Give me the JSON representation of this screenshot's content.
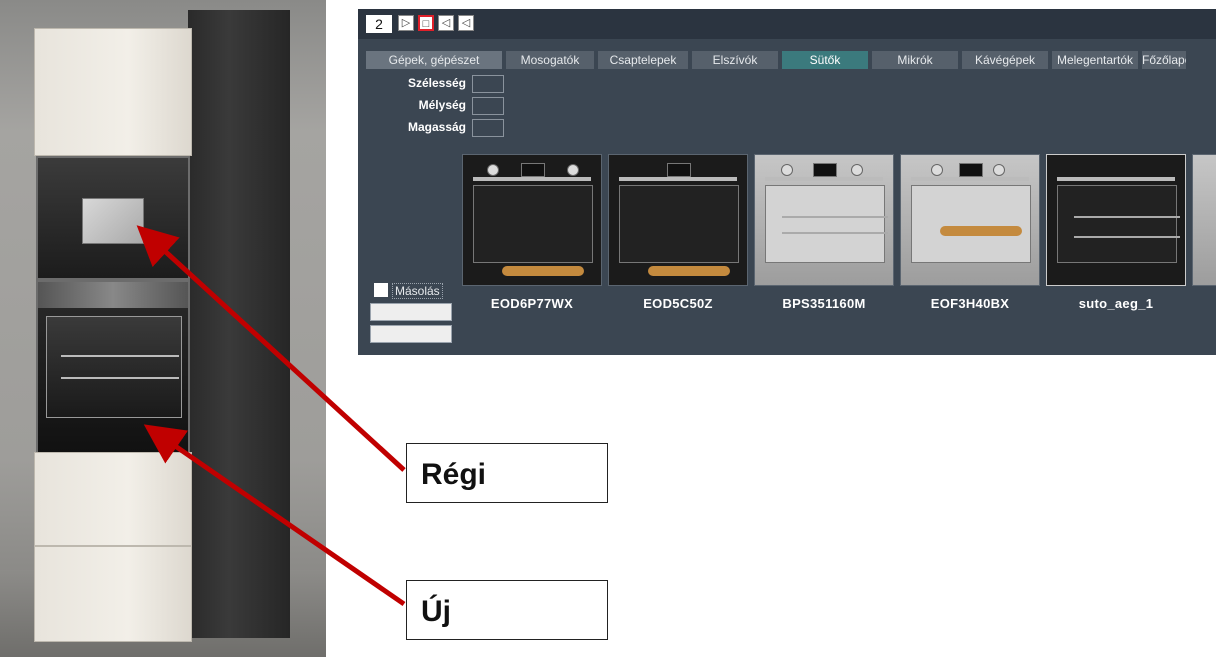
{
  "toolbar": {
    "number": "2"
  },
  "categories": [
    "Gépek, gépészet",
    "Mosogatók",
    "Csaptelepek",
    "Elszívók",
    "Sütők",
    "Mikrók",
    "Kávégépek",
    "Melegentartók",
    "Főzőlapo"
  ],
  "selected_category": "Sütők",
  "dimensions": {
    "width_label": "Szélesség",
    "depth_label": "Mélység",
    "height_label": "Magasság"
  },
  "products": [
    {
      "name": "EOD6P77WX"
    },
    {
      "name": "EOD5C50Z"
    },
    {
      "name": "BPS351160M"
    },
    {
      "name": "EOF3H40BX"
    },
    {
      "name": "suto_aeg_1"
    }
  ],
  "copy_label": "Másolás",
  "callouts": {
    "old": "Régi",
    "new": "Új"
  },
  "colors": {
    "window_bg": "#3b4652",
    "selected_tab": "#3b7a7d",
    "arrow": "#c00000"
  }
}
